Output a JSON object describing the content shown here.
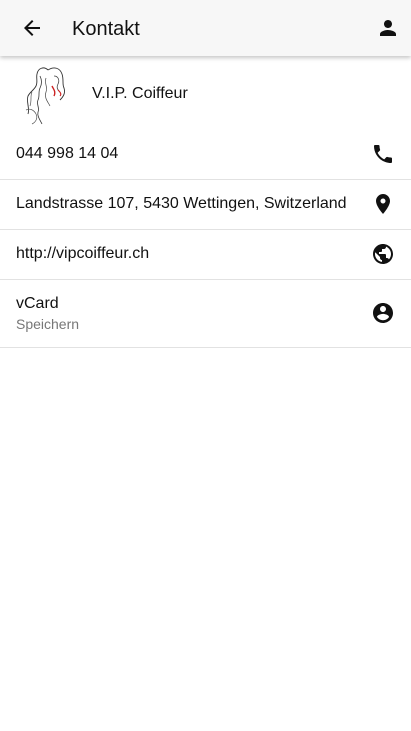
{
  "appbar": {
    "title": "Kontakt"
  },
  "company": {
    "name": "V.I.P. Coiffeur"
  },
  "contacts": {
    "phone": "044 998 14 04",
    "address": "Landstrasse 107, 5430 Wettingen, Switzerland",
    "website": "http://vipcoiffeur.ch",
    "vcard_title": "vCard",
    "vcard_subtitle": "Speichern"
  }
}
